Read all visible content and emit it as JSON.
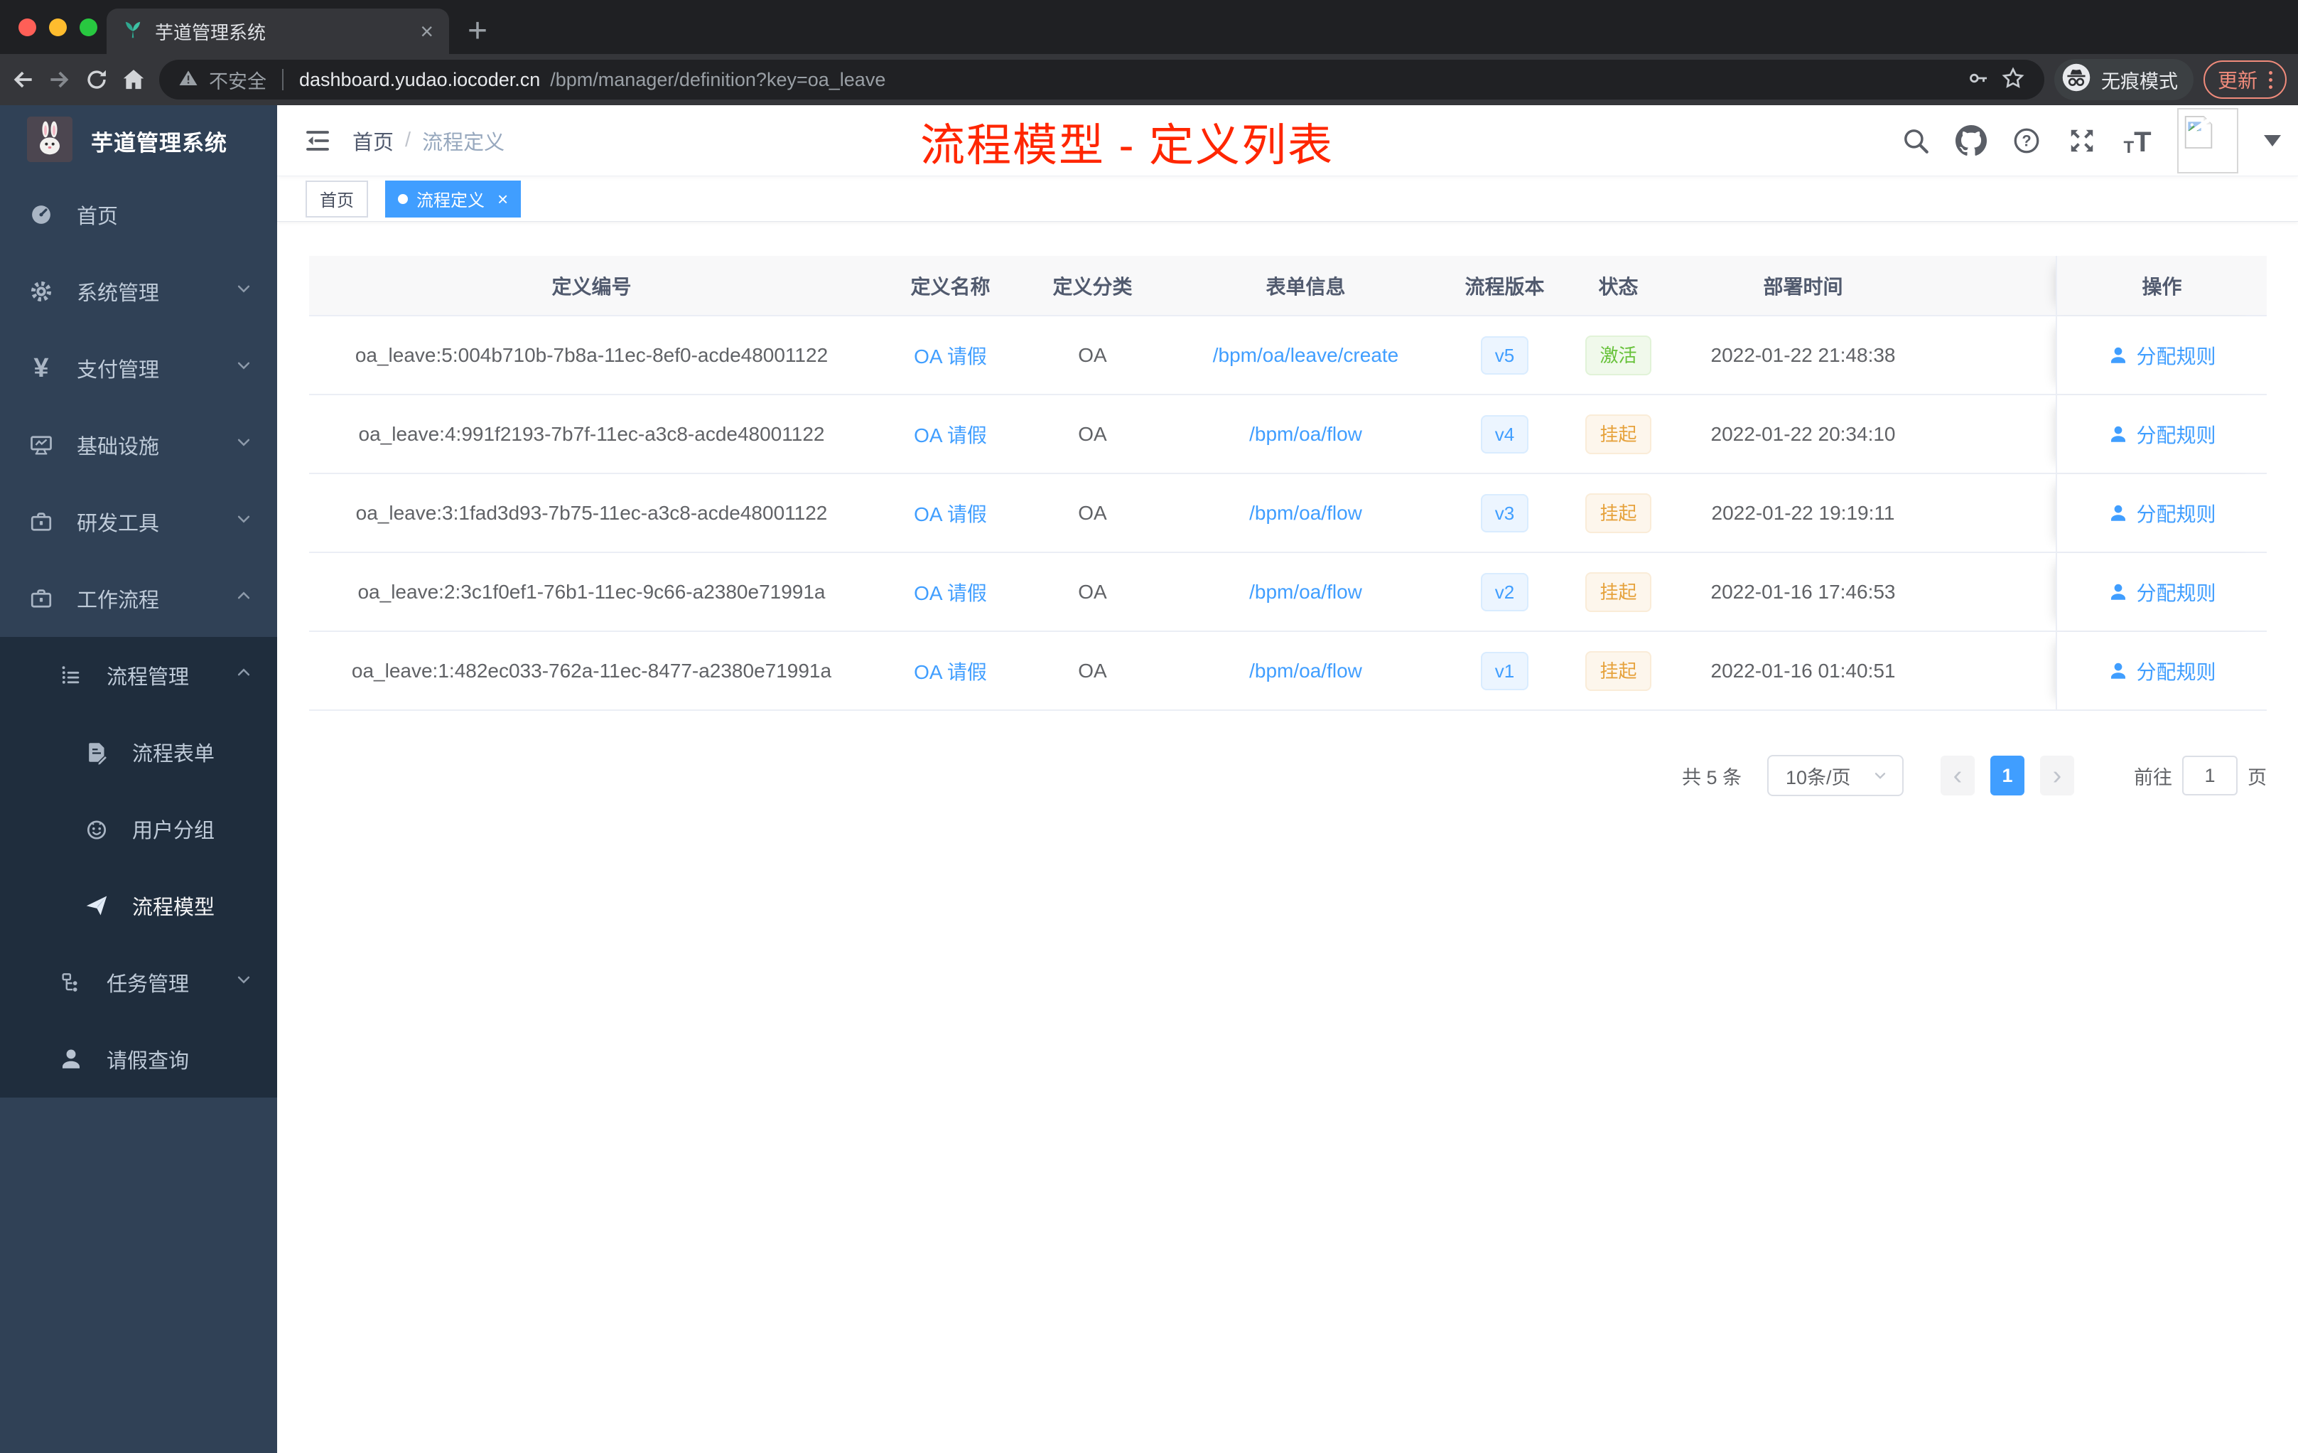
{
  "browser": {
    "tab_title": "芋道管理系统",
    "new_tab_glyph": "+",
    "tab_close_glyph": "×",
    "not_secure": "不安全",
    "url_domain": "dashboard.yudao.iocoder.cn",
    "url_path": "/bpm/manager/definition?key=oa_leave",
    "incognito_label": "无痕模式",
    "update_label": "更新"
  },
  "sidebar": {
    "title": "芋道管理系统",
    "items": [
      {
        "label": "首页"
      },
      {
        "label": "系统管理"
      },
      {
        "label": "支付管理"
      },
      {
        "label": "基础设施"
      },
      {
        "label": "研发工具"
      },
      {
        "label": "工作流程"
      },
      {
        "label": "流程管理"
      },
      {
        "label": "流程表单"
      },
      {
        "label": "用户分组"
      },
      {
        "label": "流程模型"
      },
      {
        "label": "任务管理"
      },
      {
        "label": "请假查询"
      }
    ]
  },
  "header": {
    "breadcrumb": {
      "home": "首页",
      "separator": "/",
      "current": "流程定义"
    }
  },
  "annotation": {
    "text": "流程模型 - 定义列表",
    "color": "#ff2600"
  },
  "tags": {
    "home": "首页",
    "active": "流程定义",
    "close_glyph": "×"
  },
  "table": {
    "columns": [
      "定义编号",
      "定义名称",
      "定义分类",
      "表单信息",
      "流程版本",
      "状态",
      "部署时间",
      "操作"
    ],
    "rows": [
      {
        "id": "oa_leave:5:004b710b-7b8a-11ec-8ef0-acde48001122",
        "name": "OA 请假",
        "category": "OA",
        "form": "/bpm/oa/leave/create",
        "version": "v5",
        "status": "激活",
        "status_type": "success",
        "deployed_at": "2022-01-22 21:48:38",
        "action": "分配规则"
      },
      {
        "id": "oa_leave:4:991f2193-7b7f-11ec-a3c8-acde48001122",
        "name": "OA 请假",
        "category": "OA",
        "form": "/bpm/oa/flow",
        "version": "v4",
        "status": "挂起",
        "status_type": "warning",
        "deployed_at": "2022-01-22 20:34:10",
        "action": "分配规则"
      },
      {
        "id": "oa_leave:3:1fad3d93-7b75-11ec-a3c8-acde48001122",
        "name": "OA 请假",
        "category": "OA",
        "form": "/bpm/oa/flow",
        "version": "v3",
        "status": "挂起",
        "status_type": "warning",
        "deployed_at": "2022-01-22 19:19:11",
        "action": "分配规则"
      },
      {
        "id": "oa_leave:2:3c1f0ef1-76b1-11ec-9c66-a2380e71991a",
        "name": "OA 请假",
        "category": "OA",
        "form": "/bpm/oa/flow",
        "version": "v2",
        "status": "挂起",
        "status_type": "warning",
        "deployed_at": "2022-01-16 17:46:53",
        "action": "分配规则"
      },
      {
        "id": "oa_leave:1:482ec033-762a-11ec-8477-a2380e71991a",
        "name": "OA 请假",
        "category": "OA",
        "form": "/bpm/oa/flow",
        "version": "v1",
        "status": "挂起",
        "status_type": "warning",
        "deployed_at": "2022-01-16 01:40:51",
        "action": "分配规则"
      }
    ]
  },
  "pagination": {
    "total": "共 5 条",
    "page_size": "10条/页",
    "prev_glyph": "‹",
    "current_page": "1",
    "next_glyph": "›",
    "goto_label": "前往",
    "goto_value": "1",
    "unit": "页"
  },
  "colors": {
    "accent": "#409eff",
    "success": "#67c23a",
    "warning": "#e6a23c",
    "annotation_red": "#ff2600",
    "sidebar_bg": "#304156",
    "submenu_bg": "#1f2d3d",
    "header_bg": "#f8f8f9"
  }
}
